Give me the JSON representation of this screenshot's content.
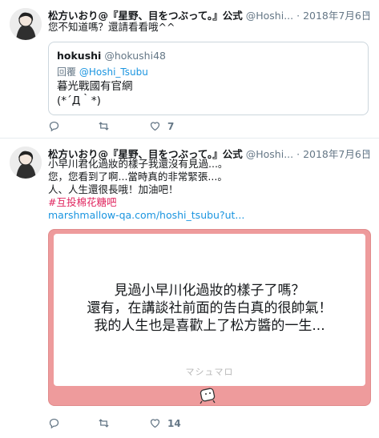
{
  "tweets": [
    {
      "author_name": "松方いおり@『星野、目をつぶって。』公式",
      "author_handle": "@Hoshi...",
      "separator": "·",
      "time": "2018年7月6日",
      "text_lines": [
        "您不知道嗎？還請看看哦^^"
      ],
      "quote": {
        "name": "hokushi",
        "handle": "@hokushi48",
        "reply_prefix": "回覆",
        "reply_to": "@Hoshi_Tsubu",
        "body_lines": [
          "暮光戰國有官網",
          "(*´Д｀*)"
        ]
      },
      "actions": {
        "reply_count": "",
        "retweet_count": "",
        "like_count": "7"
      }
    },
    {
      "author_name": "松方いおり@『星野、目をつぶって。』公式",
      "author_handle": "@Hoshi...",
      "separator": "·",
      "time": "2018年7月6日",
      "text_lines": [
        "小早川君化過妝的樣子我還沒有見過...。",
        "您，您看到了啊...當時真的非常緊張...。",
        "人、人生還很長哦！加油吧！"
      ],
      "hashtag": "#互投棉花糖吧",
      "link": "marshmallow-qa.com/hoshi_tsubu?ut...",
      "card": {
        "message_lines": [
          "見過小早川化過妝的樣子了嗎？",
          "還有，在講談社前面的告白真的很帥氣！",
          "我的人生也是喜歡上了松方醬的一生..."
        ],
        "brand": "マシュマロ"
      },
      "actions": {
        "reply_count": "",
        "retweet_count": "",
        "like_count": "14"
      }
    }
  ],
  "icons": [
    "avatar",
    "chevron-down-icon",
    "reply-icon",
    "retweet-icon",
    "like-icon",
    "marshmallow-mascot-icon"
  ],
  "colors": {
    "card_background": "#ee9b9c",
    "link": "#1b95e0",
    "hashtag": "#e0245e",
    "muted": "#657786"
  }
}
